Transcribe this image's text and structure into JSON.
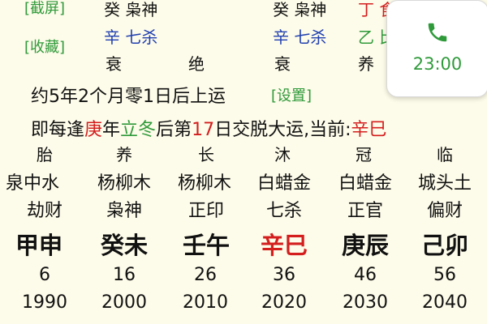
{
  "sidebar": {
    "screenshot_link": "[截屏]",
    "favorite_link": "[收藏]"
  },
  "top_rows": {
    "row1": {
      "c1": "癸 枭神",
      "c2": "癸 枭神",
      "c3": "丁 ",
      "c3b": "食"
    },
    "row2": {
      "c1": "辛 七杀",
      "c2": "辛 七杀",
      "c3": "乙 ",
      "c3b": "比"
    },
    "row3": {
      "c1": "衰",
      "c1b": "绝",
      "c2": "衰",
      "c3": "养"
    }
  },
  "start_luck": {
    "text": "约5年2个月零1日后上运",
    "settings_link": "[设置]"
  },
  "transition": {
    "prefix": "即每逢",
    "stem": "庚",
    "mid1": "年",
    "term": "立冬",
    "mid2": "后第",
    "day": "17",
    "mid3": "日交脱大运,当前:",
    "current": "辛巳"
  },
  "luck_columns": {
    "stages": [
      "胎",
      "养",
      "长",
      "沐",
      "冠",
      "临"
    ],
    "nayin": [
      "泉中水",
      "杨柳木",
      "杨柳木",
      "白蜡金",
      "白蜡金",
      "城头土"
    ],
    "gods": [
      "劫财",
      "枭神",
      "正印",
      "七杀",
      "正官",
      "偏财"
    ],
    "pillars": [
      "甲申",
      "癸未",
      "壬午",
      "辛巳",
      "庚辰",
      "己卯"
    ],
    "ages": [
      "6",
      "16",
      "26",
      "36",
      "46",
      "56"
    ],
    "years": [
      "1990",
      "2000",
      "2010",
      "2020",
      "2030",
      "2040"
    ]
  },
  "call_widget": {
    "icon": "phone-icon",
    "time": "23:00"
  },
  "colors": {
    "green": "#2f9a3a",
    "blue": "#1f3fb0",
    "red": "#d41e1e"
  }
}
